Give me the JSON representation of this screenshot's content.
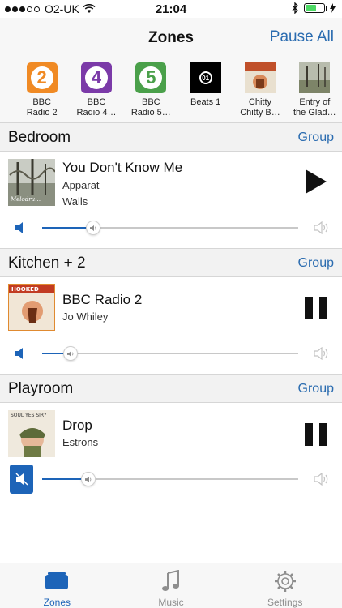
{
  "status_bar": {
    "carrier": "O2-UK",
    "time": "21:04",
    "signal_bars_filled": 3,
    "signal_bars_total": 5,
    "battery_level": 0.6
  },
  "nav": {
    "title": "Zones",
    "pause_all_label": "Pause All"
  },
  "presets": [
    {
      "name": "BBC\nRadio 2",
      "icon": "radio-2-icon",
      "color": "#f08a24",
      "glyph": "2"
    },
    {
      "name": "BBC\nRadio 4…",
      "icon": "radio-4-extra-icon",
      "color": "#7b3aa8",
      "glyph": "4"
    },
    {
      "name": "BBC\nRadio 5…",
      "icon": "radio-5-live-icon",
      "color": "#4aa04a",
      "glyph": "5"
    },
    {
      "name": "Beats 1",
      "icon": "beats-1-icon",
      "color": "#000000",
      "glyph": "01"
    },
    {
      "name": "Chitty\nChitty B…",
      "icon": "album-art-chitty",
      "color": "#b85d2a",
      "glyph": ""
    },
    {
      "name": "Entry of\nthe Glad…",
      "icon": "album-art-entry",
      "color": "#6f7766",
      "glyph": ""
    }
  ],
  "zones": [
    {
      "name": "Bedroom",
      "group_label": "Group",
      "track_title": "You Don't Know Me",
      "artist": "Apparat",
      "album": "Walls",
      "playback": "paused",
      "volume": 0.2,
      "muted": false,
      "cover_text": "Melodru…"
    },
    {
      "name": "Kitchen + 2",
      "group_label": "Group",
      "track_title": "BBC Radio 2",
      "artist": "Jo Whiley",
      "album": "",
      "playback": "playing",
      "volume": 0.11,
      "muted": false,
      "cover_text": "HOOKED"
    },
    {
      "name": "Playroom",
      "group_label": "Group",
      "track_title": "Drop",
      "artist": "Estrons",
      "album": "",
      "playback": "playing",
      "volume": 0.18,
      "muted": true,
      "cover_text": "SOUL YES SIR?"
    }
  ],
  "tabs": [
    {
      "label": "Zones",
      "active": true
    },
    {
      "label": "Music",
      "active": false
    },
    {
      "label": "Settings",
      "active": false
    }
  ],
  "colors": {
    "accent": "#1d64b8",
    "link": "#2b6cb0",
    "battery": "#4cd964"
  }
}
